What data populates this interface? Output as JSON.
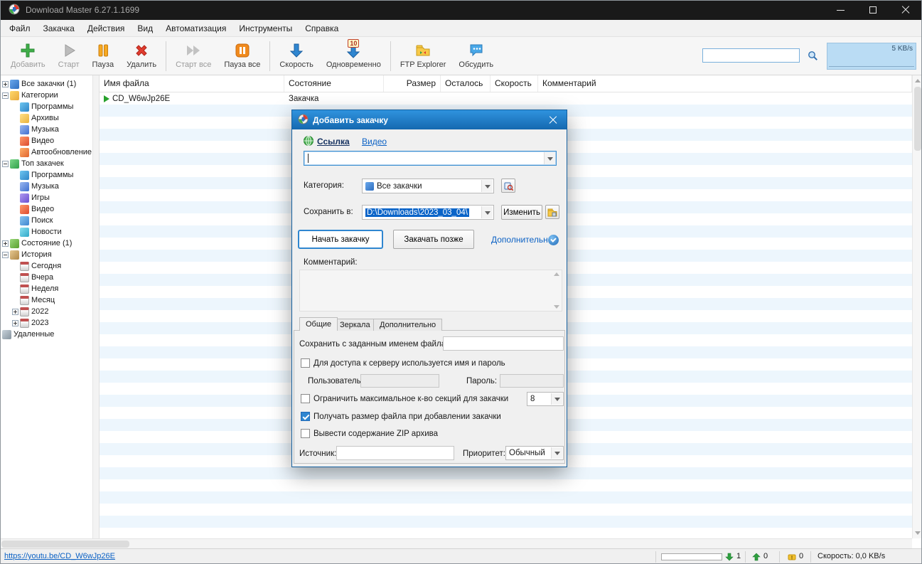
{
  "colors": {
    "titlebar": "#191919",
    "accent": "#2f86d0",
    "link": "#0b61c4",
    "selection": "#0a64c8",
    "stripe": "#edf6fd",
    "dialog_title_top": "#2f93de",
    "dialog_title_bottom": "#1568b0",
    "speed_panel_bg": "#badcf4"
  },
  "window": {
    "title": "Download Master 6.27.1.1699"
  },
  "menu": {
    "items": [
      "Файл",
      "Закачка",
      "Действия",
      "Вид",
      "Автоматизация",
      "Инструменты",
      "Справка"
    ]
  },
  "toolbar": {
    "add": "Добавить",
    "start": "Старт",
    "pause": "Пауза",
    "delete": "Удалить",
    "start_all": "Старт все",
    "pause_all": "Пауза все",
    "speed": "Скорость",
    "simultaneous": "Одновременно",
    "simultaneous_badge": "10",
    "ftp": "FTP Explorer",
    "discuss": "Обсудить",
    "search_value": "",
    "speed_panel": "5 KB/s"
  },
  "sidebar": {
    "items": [
      "Все закачки (1)",
      "Категории",
      "Программы",
      "Архивы",
      "Музыка",
      "Видео",
      "Автообновление",
      "Топ закачек",
      "Программы",
      "Музыка",
      "Игры",
      "Видео",
      "Поиск",
      "Новости",
      "Состояние (1)",
      "История",
      "Сегодня",
      "Вчера",
      "Неделя",
      "Месяц",
      "2022",
      "2023",
      "Удаленные"
    ]
  },
  "table": {
    "columns": [
      "Имя файла",
      "Состояние",
      "Размер",
      "Осталось",
      "Скорость",
      "Комментарий"
    ],
    "rows": [
      {
        "name": "CD_W6wJp26E",
        "state": "Закачка"
      }
    ]
  },
  "dialog": {
    "title": "Добавить закачку",
    "tab_link": "Ссылка",
    "tab_video": "Видео",
    "url_value": "",
    "category_label": "Категория:",
    "category_value": "Все закачки",
    "save_label": "Сохранить в:",
    "save_path": "D:\\Downloads\\2023_03_04\\",
    "change_button": "Изменить",
    "start_button": "Начать закачку",
    "later_button": "Закачать позже",
    "advanced_link": "Дополнительно",
    "comment_label": "Комментарий:",
    "comment_value": "",
    "tabs": [
      "Общие",
      "Зеркала",
      "Дополнительно"
    ],
    "filename_label": "Сохранить с заданным именем файла:",
    "filename_value": "",
    "auth_checkbox_label": "Для доступа к серверу используется имя и пароль",
    "user_label": "Пользователь:",
    "user_value": "",
    "password_label": "Пароль:",
    "password_value": "",
    "sections_checkbox_label": "Ограничить максимальное к-во секций для закачки",
    "sections_value": "8",
    "filesize_checkbox_label": "Получать размер файла при добавлении закачки",
    "zip_checkbox_label": "Вывести содержание ZIP архива",
    "source_label": "Источник:",
    "source_value": "",
    "priority_label": "Приоритет:",
    "priority_value": "Обычный"
  },
  "statusbar": {
    "link": "https://youtu.be/CD_W6wJp26E",
    "downloads": "1",
    "uploads": "0",
    "alerts": "0",
    "speed_text": "Скорость: 0,0 KB/s"
  }
}
